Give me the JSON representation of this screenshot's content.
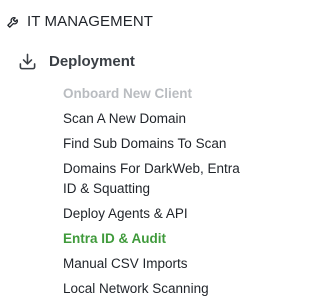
{
  "nav": {
    "section": {
      "label": "IT MANAGEMENT",
      "icon": "wrench-icon"
    },
    "group": {
      "label": "Deployment",
      "icon": "download-icon"
    },
    "items": [
      {
        "label": "Onboard New Client",
        "state": "disabled"
      },
      {
        "label": "Scan A New Domain",
        "state": "normal"
      },
      {
        "label": "Find Sub Domains To Scan",
        "state": "normal"
      },
      {
        "label": "Domains For DarkWeb, Entra ID & Squatting",
        "state": "normal"
      },
      {
        "label": "Deploy Agents & API",
        "state": "normal"
      },
      {
        "label": "Entra ID & Audit",
        "state": "active"
      },
      {
        "label": "Manual CSV Imports",
        "state": "normal"
      },
      {
        "label": "Local Network Scanning",
        "state": "normal"
      }
    ]
  },
  "colors": {
    "active": "#3f9a3b",
    "disabled": "#b9bcc0",
    "text": "#1f2329"
  }
}
